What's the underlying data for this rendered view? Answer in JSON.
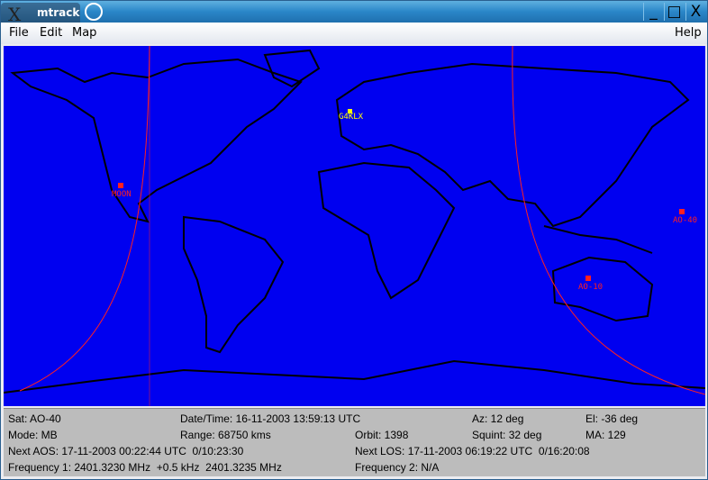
{
  "window": {
    "title": "mtrack"
  },
  "menu": {
    "file": "File",
    "edit": "Edit",
    "map": "Map",
    "help": "Help"
  },
  "map": {
    "markers": [
      {
        "name": "G4KLX",
        "color": "#ffff00"
      },
      {
        "name": "MOON",
        "color": "#ff0000"
      },
      {
        "name": "AO-10",
        "color": "#ff0000"
      },
      {
        "name": "AO-40",
        "color": "#ff0000"
      }
    ],
    "colors": {
      "ocean": "#0000f0",
      "land_outline": "#000000",
      "footprint": "#ff0000"
    }
  },
  "status": {
    "sat": "Sat: AO-40",
    "datetime": "Date/Time: 16-11-2003 13:59:13 UTC",
    "az": "Az: 12 deg",
    "el": "El: -36 deg",
    "mode": "Mode: MB",
    "range": "Range: 68750 kms",
    "orbit": "Orbit: 1398",
    "squint": "Squint: 32 deg",
    "ma": "MA: 129",
    "next_aos": "Next AOS: 17-11-2003 00:22:44 UTC  0/10:23:30",
    "next_los": "Next LOS: 17-11-2003 06:19:22 UTC  0/16:20:08",
    "freq1": "Frequency 1: 2401.3230 MHz  +0.5 kHz  2401.3235 MHz",
    "freq2": "Frequency 2: N/A"
  }
}
